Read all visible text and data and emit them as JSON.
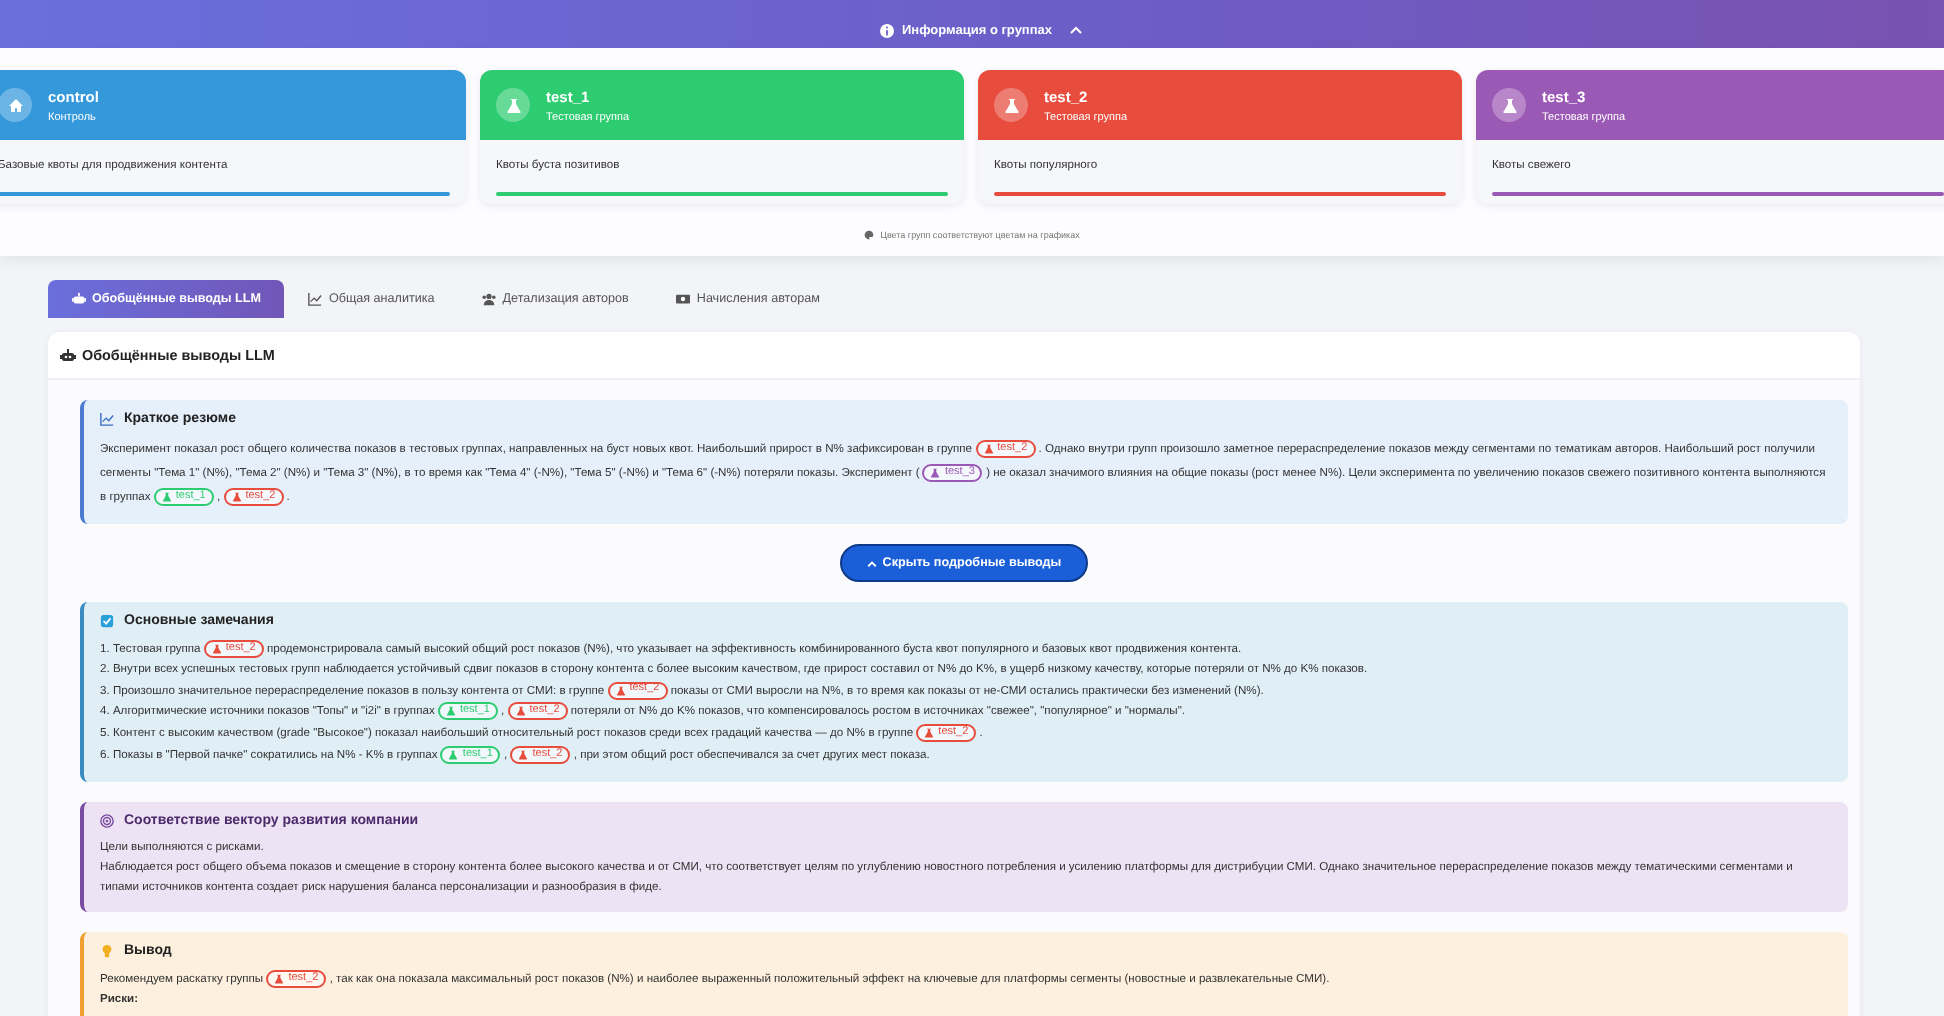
{
  "info_toggle": {
    "label": "Информация о группах",
    "expanded": true
  },
  "groups": [
    {
      "kind": "control",
      "name": "control",
      "subtitle": "Контроль",
      "description": "Базовые квоты для продвижения контента",
      "color": "#3498db"
    },
    {
      "kind": "test",
      "name": "test_1",
      "subtitle": "Тестовая группа",
      "description": "Квоты буста позитивов",
      "color": "#2ecc71"
    },
    {
      "kind": "test",
      "name": "test_2",
      "subtitle": "Тестовая группа",
      "description": "Квоты популярного",
      "color": "#e74c3c"
    },
    {
      "kind": "test",
      "name": "test_3",
      "subtitle": "Тестовая группа",
      "description": "Квоты свежего",
      "color": "#9b59b6"
    }
  ],
  "groups_note": "Цвета групп соответствуют цветам на графиках",
  "tabs": [
    {
      "label": "Обобщённые выводы LLM",
      "selected": true
    },
    {
      "label": "Общая аналитика",
      "selected": false
    },
    {
      "label": "Детализация авторов",
      "selected": false
    },
    {
      "label": "Начисления авторам",
      "selected": false
    }
  ],
  "panel": {
    "title": "Обобщённые выводы LLM",
    "sections": [
      {
        "kind": "summary",
        "title": "Краткое резюме",
        "paragraphs": [
          [
            {
              "text": "Эксперимент показал рост общего количества показов в тестовых группах, направленных на буст новых квот. Наибольший прирост в N% зафиксирован в группе "
            },
            {
              "tag": "test_2",
              "color": "#e74c3c"
            },
            {
              "text": " . Однако внутри групп произошло заметное перераспределение показов между сегментами по тематикам авторов. Наибольший рост получили сегменты \"Тема 1\" (N%), \"Тема 2\" (N%) и \"Тема 3\" (N%), в то время как \"Тема 4\" (-N%), \"Тема 5\" (-N%) и \"Тема 6\" (-N%) потеряли показы. Эксперимент ( "
            },
            {
              "tag": "test_3",
              "color": "#9b59b6"
            },
            {
              "text": " ) не оказал значимого влияния на общие показы (рост менее N%). Цели эксперимента по увеличению показов свежего позитивного контента выполняются в группах "
            },
            {
              "tag": "test_1",
              "color": "#2ecc71"
            },
            {
              "text": " , "
            },
            {
              "tag": "test_2",
              "color": "#e74c3c"
            },
            {
              "text": " ."
            }
          ]
        ]
      },
      {
        "kind": "button",
        "label": "Скрыть подробные выводы",
        "expanded": true
      },
      {
        "kind": "notes",
        "title": "Основные замечания",
        "paragraphs": [
          [
            {
              "text": "1. Тестовая группа "
            },
            {
              "tag": "test_2",
              "color": "#e74c3c"
            },
            {
              "text": " продемонстрировала самый высокий общий рост показов (N%), что указывает на эффективность комбинированного буста квот популярного и базовых квот продвижения контента."
            }
          ],
          [
            {
              "text": "2. Внутри всех успешных тестовых групп наблюдается устойчивый сдвиг показов в сторону контента с более высоким качеством, где прирост составил от N% до K%, в ущерб низкому качеству, которые потеряли от N% до K% показов."
            }
          ],
          [
            {
              "text": "3. Произошло значительное перераспределение показов в пользу контента от СМИ: в группе "
            },
            {
              "tag": "test_2",
              "color": "#e74c3c"
            },
            {
              "text": " показы от СМИ выросли на N%, в то время как показы от не-СМИ остались практически без изменений (N%)."
            }
          ],
          [
            {
              "text": "4. Алгоритмические источники показов \"Топы\" и \"i2i\" в группах "
            },
            {
              "tag": "test_1",
              "color": "#2ecc71"
            },
            {
              "text": " , "
            },
            {
              "tag": "test_2",
              "color": "#e74c3c"
            },
            {
              "text": " потеряли от N% до K% показов, что компенсировалось ростом в источниках \"свежее\", \"популярное\" и \"нормалы\"."
            }
          ],
          [
            {
              "text": "5. Контент с высоким качеством (grade \"Высокое\") показал наибольший относительный рост показов среди всех градаций качества — до N% в группе "
            },
            {
              "tag": "test_2",
              "color": "#e74c3c"
            },
            {
              "text": " ."
            }
          ],
          [
            {
              "text": "6. Показы в \"Первой пачке\" сократились на N% - K% в группах "
            },
            {
              "tag": "test_1",
              "color": "#2ecc71"
            },
            {
              "text": " , "
            },
            {
              "tag": "test_2",
              "color": "#e74c3c"
            },
            {
              "text": " , при этом общий рост обеспечивался за счет других мест показа."
            }
          ]
        ]
      },
      {
        "kind": "vector",
        "title": "Соответствие вектору развития компании",
        "paragraphs": [
          [
            {
              "text": "Цели выполняются с рисками."
            }
          ],
          [
            {
              "text": "Наблюдается рост общего объема показов и смещение в сторону контента более высокого качества и от СМИ, что соответствует целям по углублению новостного потребления и усилению платформы для дистрибуции СМИ. Однако значительное перераспределение показов между тематическими сегментами и типами источников контента создает риск нарушения баланса персонализации и разнообразия в фиде."
            }
          ]
        ]
      },
      {
        "kind": "conclusion",
        "title": "Вывод",
        "paragraphs": [
          [
            {
              "text": "Рекомендуем раскатку группы "
            },
            {
              "tag": "test_2",
              "color": "#e74c3c"
            },
            {
              "text": " , так как она показала максимальный рост показов (N%) и наиболее выраженный положительный эффект на ключевые для платформы сегменты (новостные и развлекательные СМИ)."
            }
          ],
          [
            {
              "text": "**Риски:**"
            }
          ]
        ]
      }
    ]
  }
}
